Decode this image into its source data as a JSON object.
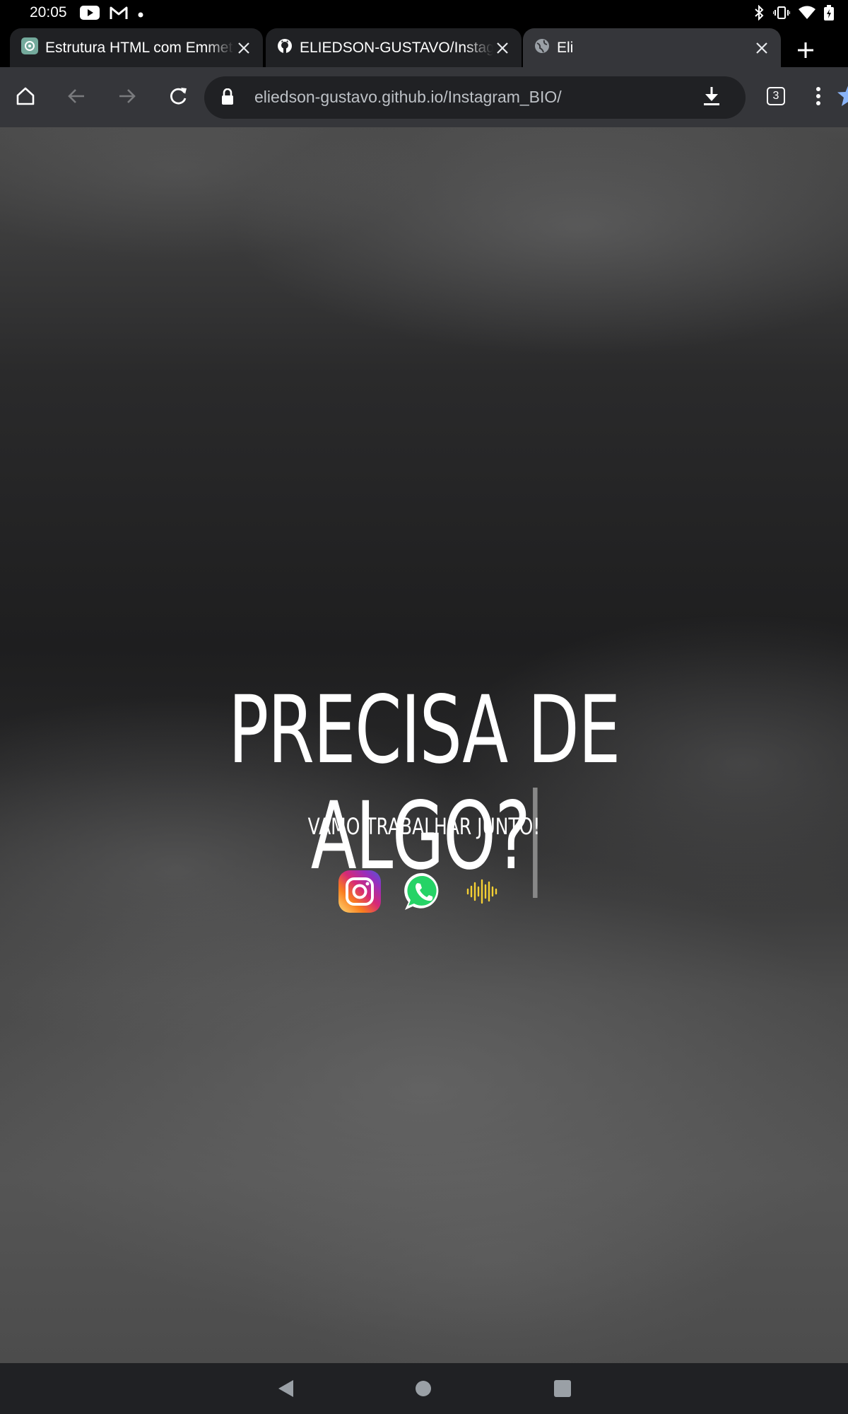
{
  "status_bar": {
    "time": "20:05",
    "left_icons": [
      "youtube-icon",
      "gmail-icon",
      "dot-icon"
    ],
    "right_icons": [
      "bluetooth-icon",
      "vibrate-icon",
      "wifi-icon",
      "battery-icon"
    ]
  },
  "tabs": [
    {
      "title": "Estrutura HTML com Emmet",
      "favicon": "chatgpt-icon",
      "active": false
    },
    {
      "title": "ELIEDSON-GUSTAVO/Instagram_BIO",
      "favicon": "github-icon",
      "active": false
    },
    {
      "title": "Eli",
      "favicon": "globe-icon",
      "active": true
    }
  ],
  "toolbar": {
    "url": "eliedson-gustavo.github.io/Instagram_BIO/",
    "tab_count": "3",
    "bookmark_color": "#8ab4f8"
  },
  "page": {
    "headline": "PRECISA DE ALGO?",
    "subheadline": "VAMO TRABALHAR JUNTO!",
    "social_icons": [
      "instagram-icon",
      "whatsapp-icon",
      "audio-wave-icon"
    ],
    "wave_color": "#f5d033"
  }
}
